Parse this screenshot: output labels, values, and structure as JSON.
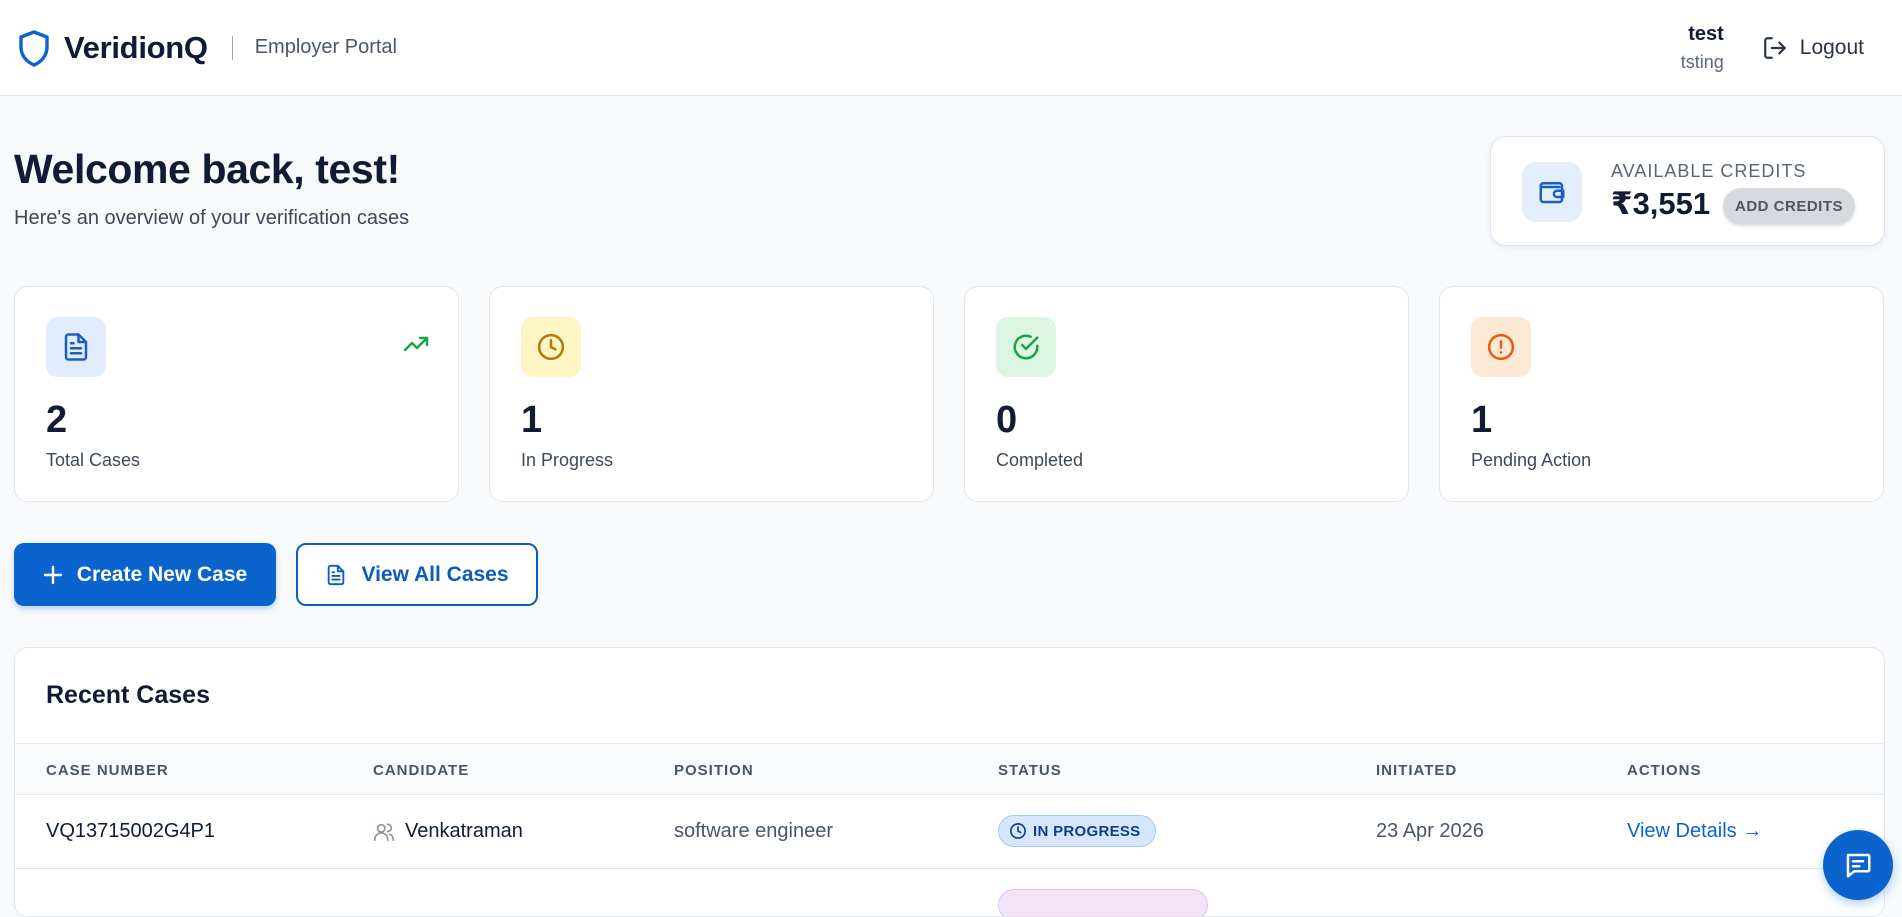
{
  "header": {
    "brand_name": "VeridionQ",
    "portal_label": "Employer Portal",
    "user_name": "test",
    "user_org": "tsting",
    "logout_label": "Logout",
    "brand_icon": "shield-icon",
    "logout_icon": "logout-icon"
  },
  "welcome": {
    "title": "Welcome back, test!",
    "subtitle": "Here's an overview of your verification cases"
  },
  "credits": {
    "label": "AVAILABLE CREDITS",
    "amount": "₹3,551",
    "add_label": "ADD CREDITS",
    "icon": "wallet-icon"
  },
  "stats": [
    {
      "value": "2",
      "label": "Total Cases",
      "icon": "document-icon",
      "icon_bg": "#e1edfc",
      "icon_color": "#1c5fc1"
    },
    {
      "value": "1",
      "label": "In Progress",
      "icon": "clock-icon",
      "icon_bg": "#fdf5c4",
      "icon_color": "#b07a0c"
    },
    {
      "value": "0",
      "label": "Completed",
      "icon": "check-circle-icon",
      "icon_bg": "#dcf6e3",
      "icon_color": "#18a34a"
    },
    {
      "value": "1",
      "label": "Pending Action",
      "icon": "alert-circle-icon",
      "icon_bg": "#fde8d3",
      "icon_color": "#e35d10"
    }
  ],
  "actions": {
    "create_label": "Create New Case",
    "view_all_label": "View All Cases"
  },
  "recent_cases": {
    "title": "Recent Cases",
    "columns": [
      "CASE NUMBER",
      "CANDIDATE",
      "POSITION",
      "STATUS",
      "INITIATED",
      "ACTIONS"
    ],
    "rows": [
      {
        "case_number": "VQ13715002G4P1",
        "candidate": "Venkatraman",
        "position": "software engineer",
        "status": "IN PROGRESS",
        "initiated": "23 Apr 2026",
        "action": "View Details →"
      }
    ]
  },
  "colors": {
    "primary": "#0b63ce",
    "text_dark": "#111b33",
    "page_bg": "#f7f9fb"
  }
}
